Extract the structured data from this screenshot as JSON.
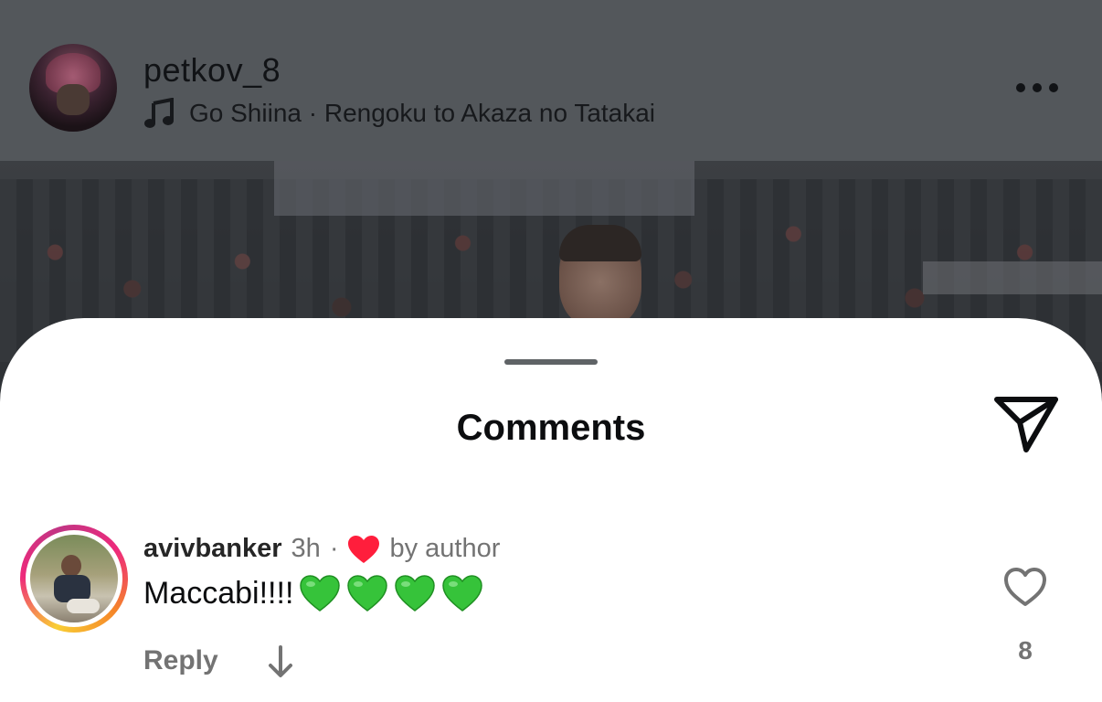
{
  "post_header": {
    "username": "petkov_8",
    "music": "Go Shiina · Rengoku to Akaza no Tatakai",
    "music_icon": "music-note-icon",
    "more_icon": "more-horizontal-icon"
  },
  "sheet": {
    "title": "Comments",
    "share_icon": "send-icon"
  },
  "comment": {
    "username": "avivbanker",
    "time": "3h",
    "separator": "·",
    "author_like_label": "by author",
    "text": "Maccabi!!!!",
    "emoji": [
      "green-heart",
      "green-heart",
      "green-heart",
      "green-heart"
    ],
    "reply_label": "Reply",
    "like_count": "8"
  },
  "colors": {
    "header_overlay": "#53575b",
    "sheet_bg": "#ffffff",
    "secondary_text": "#737373",
    "red_heart": "#ff1e3c",
    "green_heart": "#36c33a"
  }
}
